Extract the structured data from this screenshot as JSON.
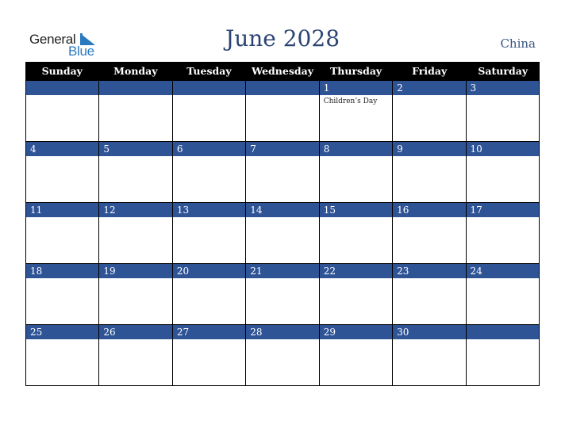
{
  "logo": {
    "line1": "General",
    "line2": "Blue"
  },
  "header": {
    "title": "June 2028",
    "country": "China"
  },
  "colors": {
    "accent": "#2e5496",
    "header_bg": "#000000",
    "title": "#2b4473"
  },
  "weekdays": [
    "Sunday",
    "Monday",
    "Tuesday",
    "Wednesday",
    "Thursday",
    "Friday",
    "Saturday"
  ],
  "weeks": [
    [
      {
        "day": "",
        "event": ""
      },
      {
        "day": "",
        "event": ""
      },
      {
        "day": "",
        "event": ""
      },
      {
        "day": "",
        "event": ""
      },
      {
        "day": "1",
        "event": "Children’s Day"
      },
      {
        "day": "2",
        "event": ""
      },
      {
        "day": "3",
        "event": ""
      }
    ],
    [
      {
        "day": "4",
        "event": ""
      },
      {
        "day": "5",
        "event": ""
      },
      {
        "day": "6",
        "event": ""
      },
      {
        "day": "7",
        "event": ""
      },
      {
        "day": "8",
        "event": ""
      },
      {
        "day": "9",
        "event": ""
      },
      {
        "day": "10",
        "event": ""
      }
    ],
    [
      {
        "day": "11",
        "event": ""
      },
      {
        "day": "12",
        "event": ""
      },
      {
        "day": "13",
        "event": ""
      },
      {
        "day": "14",
        "event": ""
      },
      {
        "day": "15",
        "event": ""
      },
      {
        "day": "16",
        "event": ""
      },
      {
        "day": "17",
        "event": ""
      }
    ],
    [
      {
        "day": "18",
        "event": ""
      },
      {
        "day": "19",
        "event": ""
      },
      {
        "day": "20",
        "event": ""
      },
      {
        "day": "21",
        "event": ""
      },
      {
        "day": "22",
        "event": ""
      },
      {
        "day": "23",
        "event": ""
      },
      {
        "day": "24",
        "event": ""
      }
    ],
    [
      {
        "day": "25",
        "event": ""
      },
      {
        "day": "26",
        "event": ""
      },
      {
        "day": "27",
        "event": ""
      },
      {
        "day": "28",
        "event": ""
      },
      {
        "day": "29",
        "event": ""
      },
      {
        "day": "30",
        "event": ""
      },
      {
        "day": "",
        "event": ""
      }
    ]
  ]
}
